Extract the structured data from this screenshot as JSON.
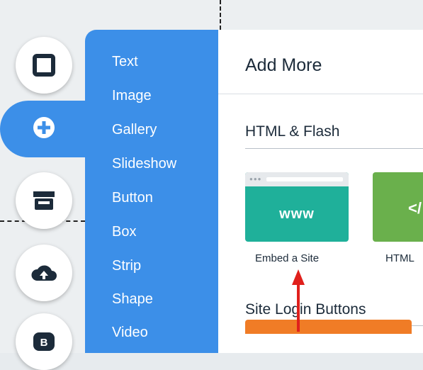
{
  "rail": {
    "items": [
      {
        "name": "square-icon"
      },
      {
        "name": "plus-icon"
      },
      {
        "name": "store-icon"
      },
      {
        "name": "upload-cloud-icon"
      },
      {
        "name": "blog-b-icon",
        "glyph": "B"
      }
    ]
  },
  "menu": {
    "items": [
      "Text",
      "Image",
      "Gallery",
      "Slideshow",
      "Button",
      "Box",
      "Strip",
      "Shape",
      "Video"
    ]
  },
  "panel": {
    "title": "Add More",
    "sections": {
      "html_flash": "HTML & Flash",
      "site_login": "Site Login Buttons"
    },
    "tiles": {
      "embed_text": "www",
      "embed_label": "Embed a Site",
      "html_glyph": "</",
      "html_label": "HTML"
    }
  },
  "colors": {
    "menu_blue": "#3c8fe8",
    "embed_teal": "#1fb09a",
    "html_green": "#6ab04c",
    "orange": "#f07c26",
    "arrow_red": "#e0201c"
  }
}
